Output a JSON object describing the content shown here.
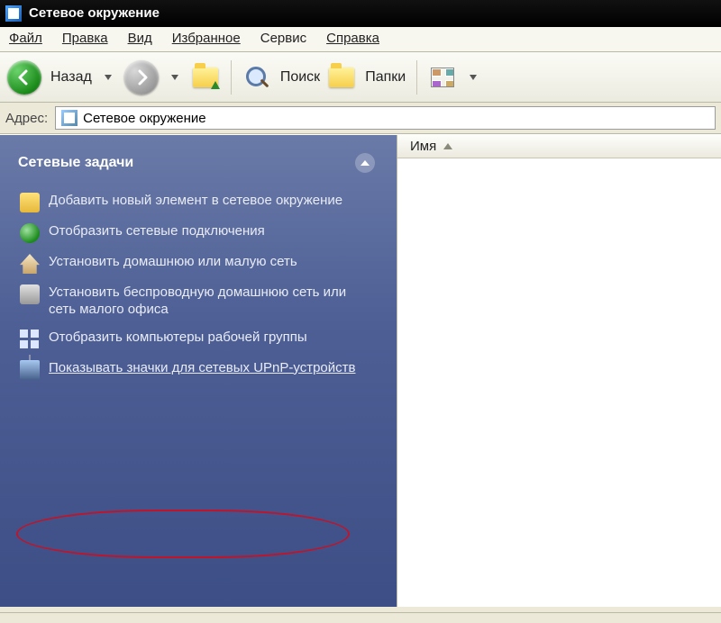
{
  "title": "Сетевое окружение",
  "menu": {
    "file": "Файл",
    "edit": "Правка",
    "view": "Вид",
    "favorites": "Избранное",
    "service": "Сервис",
    "help": "Справка"
  },
  "toolbar": {
    "back": "Назад",
    "search": "Поиск",
    "folders": "Папки"
  },
  "address": {
    "label": "Адрес:",
    "value": "Сетевое окружение"
  },
  "taskpane": {
    "header": "Сетевые задачи",
    "items": [
      "Добавить новый элемент в сетевое окружение",
      "Отобразить сетевые подключения",
      "Установить домашнюю или малую сеть",
      "Установить беспроводную домашнюю сеть или сеть малого офиса",
      "Отобразить компьютеры рабочей группы",
      "Показывать значки для сетевых UPnP-устройств"
    ]
  },
  "listpane": {
    "column_name": "Имя"
  }
}
